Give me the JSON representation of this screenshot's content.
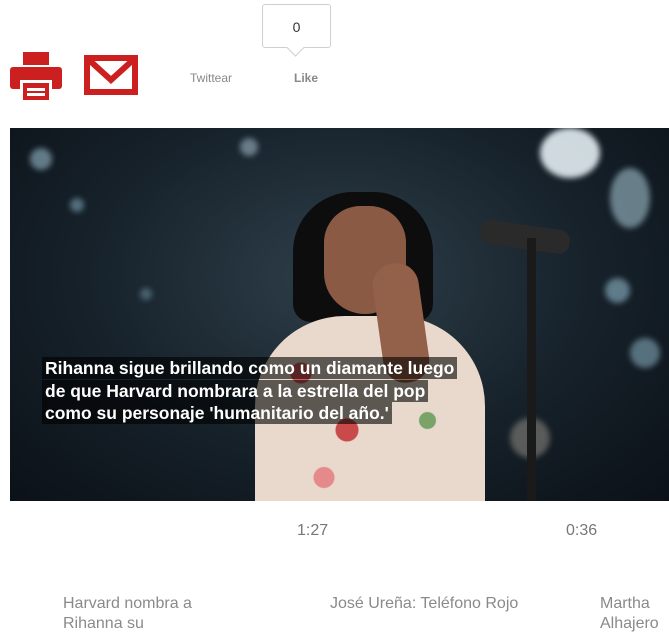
{
  "share": {
    "print_icon": "printer-icon",
    "mail_icon": "envelope-icon",
    "twitter_label": "Twittear",
    "like_count": "0",
    "like_label": "Like",
    "accent_color": "#cc1f1f"
  },
  "video": {
    "caption": "Rihanna sigue brillando como un diamante luego de que Harvard nombrara a la estrella del pop como su personaje 'humanitario del año.'"
  },
  "related": [
    {
      "duration": "",
      "title": "Harvard nombra a Rihanna su"
    },
    {
      "duration": "1:27",
      "title": "José Ureña: Teléfono Rojo"
    },
    {
      "duration": "0:36",
      "title": "Martha Alhajero"
    }
  ]
}
